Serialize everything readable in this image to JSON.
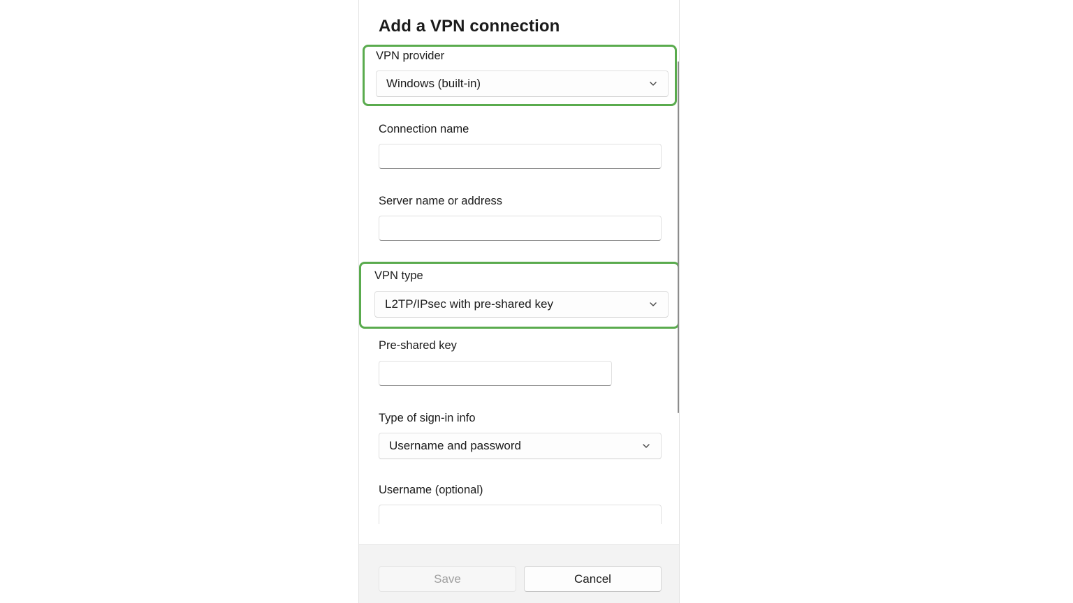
{
  "dialog": {
    "title": "Add a VPN connection"
  },
  "fields": {
    "vpn_provider": {
      "label": "VPN provider",
      "value": "Windows (built-in)"
    },
    "connection_name": {
      "label": "Connection name",
      "value": ""
    },
    "server_name": {
      "label": "Server name or address",
      "value": ""
    },
    "vpn_type": {
      "label": "VPN type",
      "value": "L2TP/IPsec with pre-shared key"
    },
    "pre_shared_key": {
      "label": "Pre-shared key",
      "value": ""
    },
    "sign_in_type": {
      "label": "Type of sign-in info",
      "value": "Username and password"
    },
    "username": {
      "label": "Username (optional)",
      "value": ""
    }
  },
  "footer": {
    "save_label": "Save",
    "cancel_label": "Cancel"
  },
  "icons": {
    "dropdown": "chevron-down-icon"
  },
  "colors": {
    "highlight": "#5aab4e",
    "footer_bg": "#f3f3f3",
    "disabled_text": "#a0a0a0"
  }
}
